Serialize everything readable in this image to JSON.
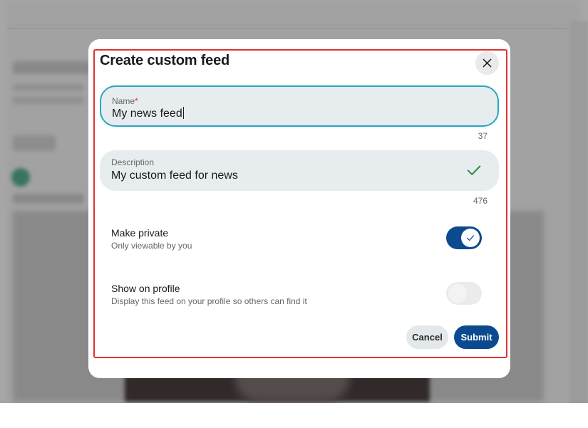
{
  "dialog": {
    "title": "Create custom feed",
    "close_icon": "close-icon"
  },
  "name_field": {
    "label": "Name",
    "required_marker": "*",
    "value": "My news feed",
    "char_counter": "37",
    "focused": true
  },
  "description_field": {
    "label": "Description",
    "value": "My custom feed for news",
    "char_counter": "476",
    "status_icon": "checkmark-icon",
    "status_color": "#2e8b3e"
  },
  "make_private": {
    "title": "Make private",
    "subtitle": "Only viewable by you",
    "enabled": true
  },
  "show_on_profile": {
    "title": "Show on profile",
    "subtitle": "Display this feed on your profile so others can find it",
    "enabled": false
  },
  "actions": {
    "cancel_label": "Cancel",
    "submit_label": "Submit"
  },
  "colors": {
    "accent": "#0b4a8f",
    "focus_border": "#2aa6c1",
    "highlight_box": "#e03232",
    "field_background": "#e7ecee"
  }
}
